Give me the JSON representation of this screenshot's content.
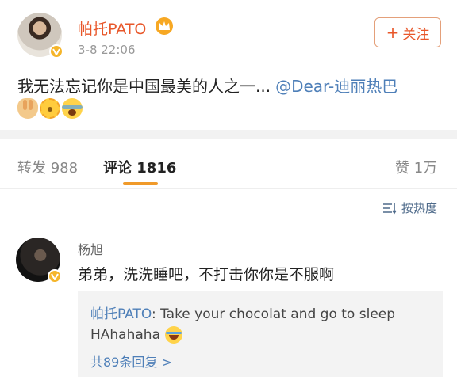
{
  "post": {
    "author": "帕托PATO",
    "time": "3-8 22:06",
    "follow_label": "关注",
    "follow_plus": "+",
    "text": "我无法忘记你是中国最美的人之一...",
    "mention": "@Dear-迪丽热巴",
    "emojis": [
      "hands-emoji",
      "sun-face-emoji",
      "scream-emoji"
    ]
  },
  "tabs": {
    "repost": "转发 988",
    "comments": "评论 1816",
    "likes": "赞 1万"
  },
  "sort": {
    "label": "按热度"
  },
  "comment": {
    "author": "杨旭",
    "text": "弟弟，洗洗睡吧，不打击你你是不服啊",
    "reply": {
      "author": "帕托PATO",
      "text1": ": Take your chocolat and go to sleep",
      "text2": "HAhahaha",
      "more": "共89条回复 >"
    }
  },
  "colors": {
    "accent": "#e8572a",
    "link": "#4e7fb8",
    "tab_indicator": "#f09a2a",
    "verified": "#f5b52a"
  }
}
